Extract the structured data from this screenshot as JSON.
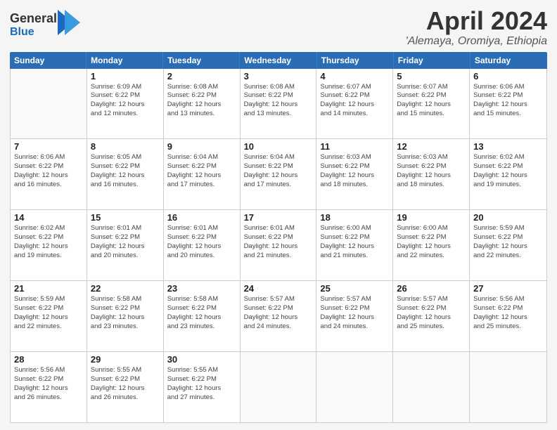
{
  "logo": {
    "general": "General",
    "blue": "Blue"
  },
  "title": "April 2024",
  "location": "'Alemaya, Oromiya, Ethiopia",
  "days_of_week": [
    "Sunday",
    "Monday",
    "Tuesday",
    "Wednesday",
    "Thursday",
    "Friday",
    "Saturday"
  ],
  "weeks": [
    [
      {
        "day": "",
        "info": ""
      },
      {
        "day": "1",
        "info": "Sunrise: 6:09 AM\nSunset: 6:22 PM\nDaylight: 12 hours\nand 12 minutes."
      },
      {
        "day": "2",
        "info": "Sunrise: 6:08 AM\nSunset: 6:22 PM\nDaylight: 12 hours\nand 13 minutes."
      },
      {
        "day": "3",
        "info": "Sunrise: 6:08 AM\nSunset: 6:22 PM\nDaylight: 12 hours\nand 13 minutes."
      },
      {
        "day": "4",
        "info": "Sunrise: 6:07 AM\nSunset: 6:22 PM\nDaylight: 12 hours\nand 14 minutes."
      },
      {
        "day": "5",
        "info": "Sunrise: 6:07 AM\nSunset: 6:22 PM\nDaylight: 12 hours\nand 15 minutes."
      },
      {
        "day": "6",
        "info": "Sunrise: 6:06 AM\nSunset: 6:22 PM\nDaylight: 12 hours\nand 15 minutes."
      }
    ],
    [
      {
        "day": "7",
        "info": "Sunrise: 6:06 AM\nSunset: 6:22 PM\nDaylight: 12 hours\nand 16 minutes."
      },
      {
        "day": "8",
        "info": "Sunrise: 6:05 AM\nSunset: 6:22 PM\nDaylight: 12 hours\nand 16 minutes."
      },
      {
        "day": "9",
        "info": "Sunrise: 6:04 AM\nSunset: 6:22 PM\nDaylight: 12 hours\nand 17 minutes."
      },
      {
        "day": "10",
        "info": "Sunrise: 6:04 AM\nSunset: 6:22 PM\nDaylight: 12 hours\nand 17 minutes."
      },
      {
        "day": "11",
        "info": "Sunrise: 6:03 AM\nSunset: 6:22 PM\nDaylight: 12 hours\nand 18 minutes."
      },
      {
        "day": "12",
        "info": "Sunrise: 6:03 AM\nSunset: 6:22 PM\nDaylight: 12 hours\nand 18 minutes."
      },
      {
        "day": "13",
        "info": "Sunrise: 6:02 AM\nSunset: 6:22 PM\nDaylight: 12 hours\nand 19 minutes."
      }
    ],
    [
      {
        "day": "14",
        "info": "Sunrise: 6:02 AM\nSunset: 6:22 PM\nDaylight: 12 hours\nand 19 minutes."
      },
      {
        "day": "15",
        "info": "Sunrise: 6:01 AM\nSunset: 6:22 PM\nDaylight: 12 hours\nand 20 minutes."
      },
      {
        "day": "16",
        "info": "Sunrise: 6:01 AM\nSunset: 6:22 PM\nDaylight: 12 hours\nand 20 minutes."
      },
      {
        "day": "17",
        "info": "Sunrise: 6:01 AM\nSunset: 6:22 PM\nDaylight: 12 hours\nand 21 minutes."
      },
      {
        "day": "18",
        "info": "Sunrise: 6:00 AM\nSunset: 6:22 PM\nDaylight: 12 hours\nand 21 minutes."
      },
      {
        "day": "19",
        "info": "Sunrise: 6:00 AM\nSunset: 6:22 PM\nDaylight: 12 hours\nand 22 minutes."
      },
      {
        "day": "20",
        "info": "Sunrise: 5:59 AM\nSunset: 6:22 PM\nDaylight: 12 hours\nand 22 minutes."
      }
    ],
    [
      {
        "day": "21",
        "info": "Sunrise: 5:59 AM\nSunset: 6:22 PM\nDaylight: 12 hours\nand 22 minutes."
      },
      {
        "day": "22",
        "info": "Sunrise: 5:58 AM\nSunset: 6:22 PM\nDaylight: 12 hours\nand 23 minutes."
      },
      {
        "day": "23",
        "info": "Sunrise: 5:58 AM\nSunset: 6:22 PM\nDaylight: 12 hours\nand 23 minutes."
      },
      {
        "day": "24",
        "info": "Sunrise: 5:57 AM\nSunset: 6:22 PM\nDaylight: 12 hours\nand 24 minutes."
      },
      {
        "day": "25",
        "info": "Sunrise: 5:57 AM\nSunset: 6:22 PM\nDaylight: 12 hours\nand 24 minutes."
      },
      {
        "day": "26",
        "info": "Sunrise: 5:57 AM\nSunset: 6:22 PM\nDaylight: 12 hours\nand 25 minutes."
      },
      {
        "day": "27",
        "info": "Sunrise: 5:56 AM\nSunset: 6:22 PM\nDaylight: 12 hours\nand 25 minutes."
      }
    ],
    [
      {
        "day": "28",
        "info": "Sunrise: 5:56 AM\nSunset: 6:22 PM\nDaylight: 12 hours\nand 26 minutes."
      },
      {
        "day": "29",
        "info": "Sunrise: 5:55 AM\nSunset: 6:22 PM\nDaylight: 12 hours\nand 26 minutes."
      },
      {
        "day": "30",
        "info": "Sunrise: 5:55 AM\nSunset: 6:22 PM\nDaylight: 12 hours\nand 27 minutes."
      },
      {
        "day": "",
        "info": ""
      },
      {
        "day": "",
        "info": ""
      },
      {
        "day": "",
        "info": ""
      },
      {
        "day": "",
        "info": ""
      }
    ]
  ]
}
